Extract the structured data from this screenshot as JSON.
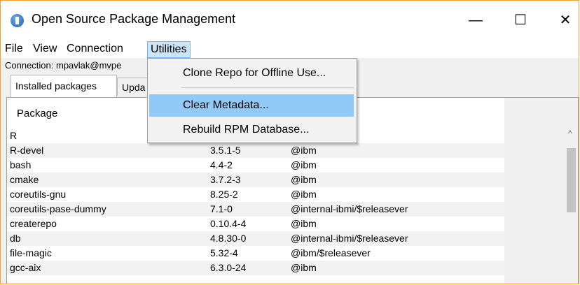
{
  "window": {
    "title": "Open Source Package Management",
    "controls": {
      "minimize": "—",
      "maximize": "☐",
      "close": "✕"
    }
  },
  "menubar": {
    "items": [
      {
        "label": "File"
      },
      {
        "label": "View"
      },
      {
        "label": "Connection"
      },
      {
        "label": "Utilities",
        "active": true
      }
    ]
  },
  "connection_label": "Connection: mpavlak@mvpe",
  "tabs": [
    {
      "label": "Installed packages",
      "active": true
    },
    {
      "label": "Upda"
    }
  ],
  "table": {
    "columns": [
      "Package"
    ],
    "rows": [
      [
        "R",
        "",
        ""
      ],
      [
        "R-devel",
        "3.5.1-5",
        "@ibm"
      ],
      [
        "bash",
        "4.4-2",
        "@ibm"
      ],
      [
        "cmake",
        "3.7.2-3",
        "@ibm"
      ],
      [
        "coreutils-gnu",
        "8.25-2",
        "@ibm"
      ],
      [
        "coreutils-pase-dummy",
        "7.1-0",
        "@internal-ibmi/$releasever"
      ],
      [
        "createrepo",
        "0.10.4-4",
        "@ibm"
      ],
      [
        "db",
        "4.8.30-0",
        "@internal-ibmi/$releasever"
      ],
      [
        "file-magic",
        "5.32-4",
        "@ibm/$releasever"
      ],
      [
        "gcc-aix",
        "6.3.0-24",
        "@ibm"
      ]
    ]
  },
  "dropdown": {
    "items": [
      {
        "label": "Clone Repo for Offline Use..."
      },
      {
        "label": "Clear Metadata...",
        "highlighted": true
      },
      {
        "label": "Rebuild RPM Database..."
      }
    ]
  },
  "colors": {
    "window_border": "#f0a030",
    "menu_active": "#cce4f7",
    "item_highlight": "#91c9f7"
  }
}
